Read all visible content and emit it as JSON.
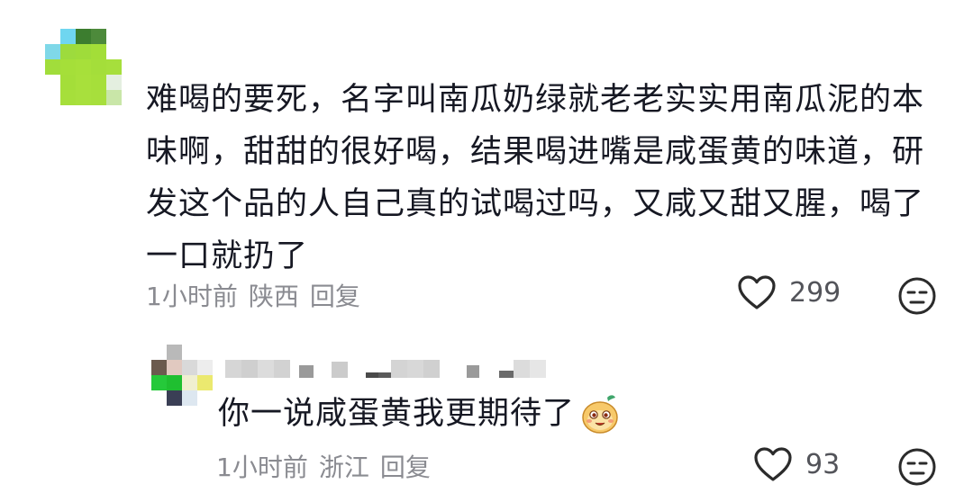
{
  "comment": {
    "text": "难喝的要死，名字叫南瓜奶绿就老老实实用南瓜泥的本味啊，甜甜的很好喝，结果喝进嘴是咸蛋黄的味道，研发这个品的人自己真的试喝过吗，又咸又甜又腥，喝了一口就扔了",
    "time": "1小时前",
    "location": "陕西",
    "reply_label": "回复",
    "like_count": "299",
    "like_icon": "heart-outline-icon",
    "dislike_icon": "meh-face-icon"
  },
  "reply": {
    "text": "你一说咸蛋黄我更期待了",
    "emoji": "smiling-mascot-emoji",
    "time": "1小时前",
    "location": "浙江",
    "reply_label": "回复",
    "like_count": "93",
    "like_icon": "heart-outline-icon",
    "dislike_icon": "meh-face-icon"
  },
  "colors": {
    "text": "#161823",
    "meta": "#8a8b91",
    "count": "#53545a",
    "icon_stroke": "#2b2b2b"
  }
}
